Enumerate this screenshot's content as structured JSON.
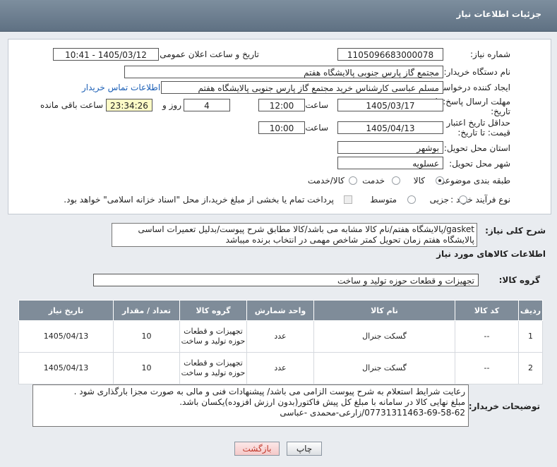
{
  "header": {
    "title": "جزئیات اطلاعات نیاز"
  },
  "form": {
    "need_number_label": "شماره نیاز:",
    "need_number": "1105096683000078",
    "announce_label": "تاریخ و ساعت اعلان عمومی:",
    "announce_value": "1405/03/12 - 10:41",
    "buyer_org_label": "نام دستگاه خریدار:",
    "buyer_org": "مجتمع گاز پارس جنوبی  پالایشگاه هفتم",
    "creator_label": "ایجاد کننده درخواست:",
    "creator": "مسلم عباسی کارشناس خرید مجتمع گاز پارس جنوبی  پالایشگاه هفتم",
    "contact_link": "اطلاعات تماس خریدار",
    "reply_deadline_label": "مهلت ارسال پاسخ: تا تاریخ:",
    "reply_date": "1405/03/17",
    "time_label": "ساعت",
    "reply_time": "12:00",
    "days_count": "4",
    "days_label": "روز و",
    "remaining_time": "23:34:26",
    "remaining_label": "ساعت باقی مانده",
    "price_validity_label": "حداقل تاریخ اعتبار قیمت: تا تاریخ:",
    "price_date": "1405/04/13",
    "price_time": "10:00",
    "province_label": "استان محل تحویل:",
    "province": "بوشهر",
    "city_label": "شهر محل تحویل:",
    "city": "عسلویه",
    "category_label": "طبقه بندی موضوعی:",
    "category_options": [
      "کالا",
      "خدمت",
      "کالا/خدمت"
    ],
    "process_label": "نوع فرآیند خرید :",
    "process_options": [
      "جزیی",
      "متوسط"
    ],
    "payment_note": "پرداخت تمام یا بخشی از مبلغ خرید،از محل \"اسناد خزانه اسلامی\" خواهد بود."
  },
  "description": {
    "label": "شرح کلی نیاز:",
    "text": "gasket/پالایشگاه هفتم/نام کالا مشابه می باشد/کالا مطابق شرح پیوست/بدلیل تعمیرات اساسی پالایشگاه هفتم زمان تحویل کمتر شاخص مهمی در انتخاب برنده میباشد"
  },
  "goods": {
    "section_title": "اطلاعات کالاهای مورد نیاز",
    "group_label": "گروه کالا:",
    "group_value": "تجهیزات و قطعات حوزه تولید و ساخت",
    "columns": [
      "ردیف",
      "کد کالا",
      "نام کالا",
      "واحد شمارش",
      "گروه کالا",
      "تعداد / مقدار",
      "تاریخ نیاز"
    ],
    "rows": [
      {
        "row": "1",
        "code": "--",
        "name": "گسکت جنرال",
        "unit": "عدد",
        "group": "تجهیزات و قطعات حوزه تولید و ساخت",
        "qty": "10",
        "date": "1405/04/13"
      },
      {
        "row": "2",
        "code": "--",
        "name": "گسکت جنرال",
        "unit": "عدد",
        "group": "تجهیزات و قطعات حوزه تولید و ساخت",
        "qty": "10",
        "date": "1405/04/13"
      }
    ]
  },
  "buyer_notes": {
    "label": "توضیحات خریدار:",
    "line1": "رعایت شرایط استعلام به شرح پیوست الزامی می باشد/ پیشنهادات فنی و مالی به صورت مجزا بارگذاری شود .",
    "line2": "مبلغ نهایی کالا در سامانه با مبلغ کل پیش فاکتور(بدون ارزش افزوده)یکسان باشد.",
    "line3": "07731311463-69-58-62/زارعی-محمدی -عباسی"
  },
  "buttons": {
    "print": "چاپ",
    "back": "بازگشت"
  }
}
